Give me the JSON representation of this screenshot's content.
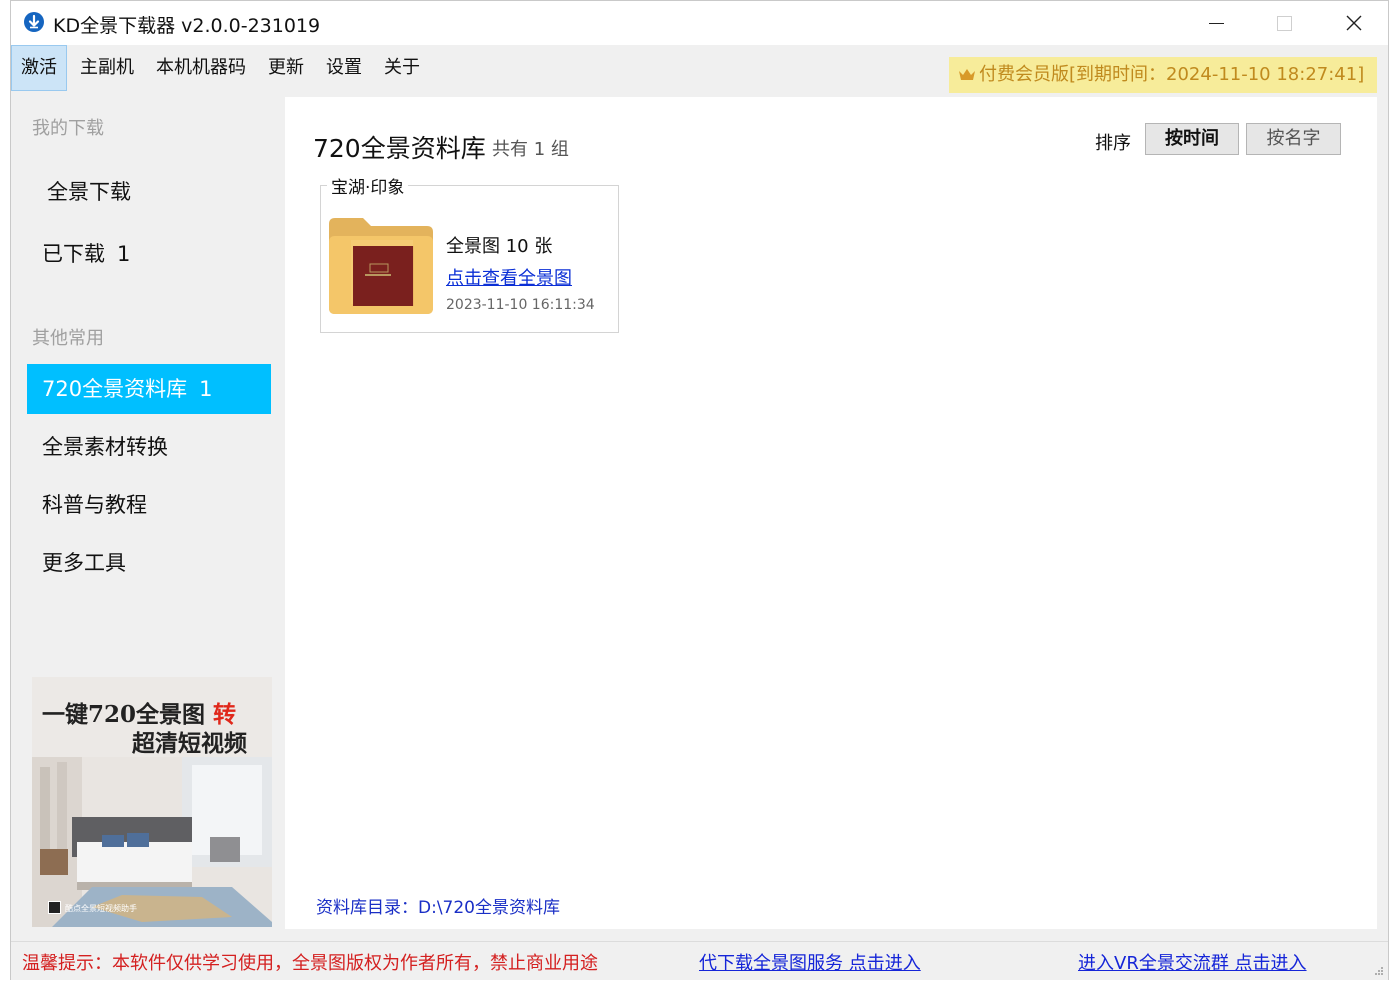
{
  "window": {
    "title": "KD全景下载器 v2.0.0-231019"
  },
  "menu": {
    "items": [
      "激活",
      "主副机",
      "本机机器码",
      "更新",
      "设置",
      "关于"
    ],
    "active_index": 0
  },
  "vip": {
    "icon": "crown-icon",
    "text": "付费会员版[到期时间：2024-11-10 18:27:41]"
  },
  "sidebar": {
    "section_my_downloads": "我的下载",
    "section_others": "其他常用",
    "items": [
      {
        "label": "全景下载",
        "count": ""
      },
      {
        "label": "已下载",
        "count": "1"
      },
      {
        "label": "720全景资料库",
        "count": "1"
      },
      {
        "label": "全景素材转换",
        "count": ""
      },
      {
        "label": "科普与教程",
        "count": ""
      },
      {
        "label": "更多工具",
        "count": ""
      }
    ],
    "selected_index": 2,
    "ad": {
      "line1": "一键720全景图 ",
      "line1_accent": "转",
      "line2": "超清短视频",
      "brand": "酷点全景短视频助手"
    }
  },
  "main": {
    "title": "720全景资料库",
    "count_text": "共有 1 组",
    "sort_label": "排序",
    "sort_by_time": "按时间",
    "sort_by_name": "按名字",
    "groups": [
      {
        "name": "宝湖·印象",
        "pano_count": "全景图 10 张",
        "view_link": "点击查看全景图",
        "date": "2023-11-10 16:11:34"
      }
    ],
    "library_path": "资料库目录：D:\\720全景资料库"
  },
  "status": {
    "notice": "温馨提示：本软件仅供学习使用，全景图版权为作者所有，禁止商业用途",
    "link_download_service": "代下载全景图服务 点击进入",
    "link_vr_group": "进入VR全景交流群 点击进入"
  },
  "colors": {
    "accent_selected": "#00bfff",
    "vip_bg": "#f7ec9a",
    "vip_text": "#c08a1e",
    "notice_red": "#d42020",
    "link_blue": "#1525d8"
  }
}
